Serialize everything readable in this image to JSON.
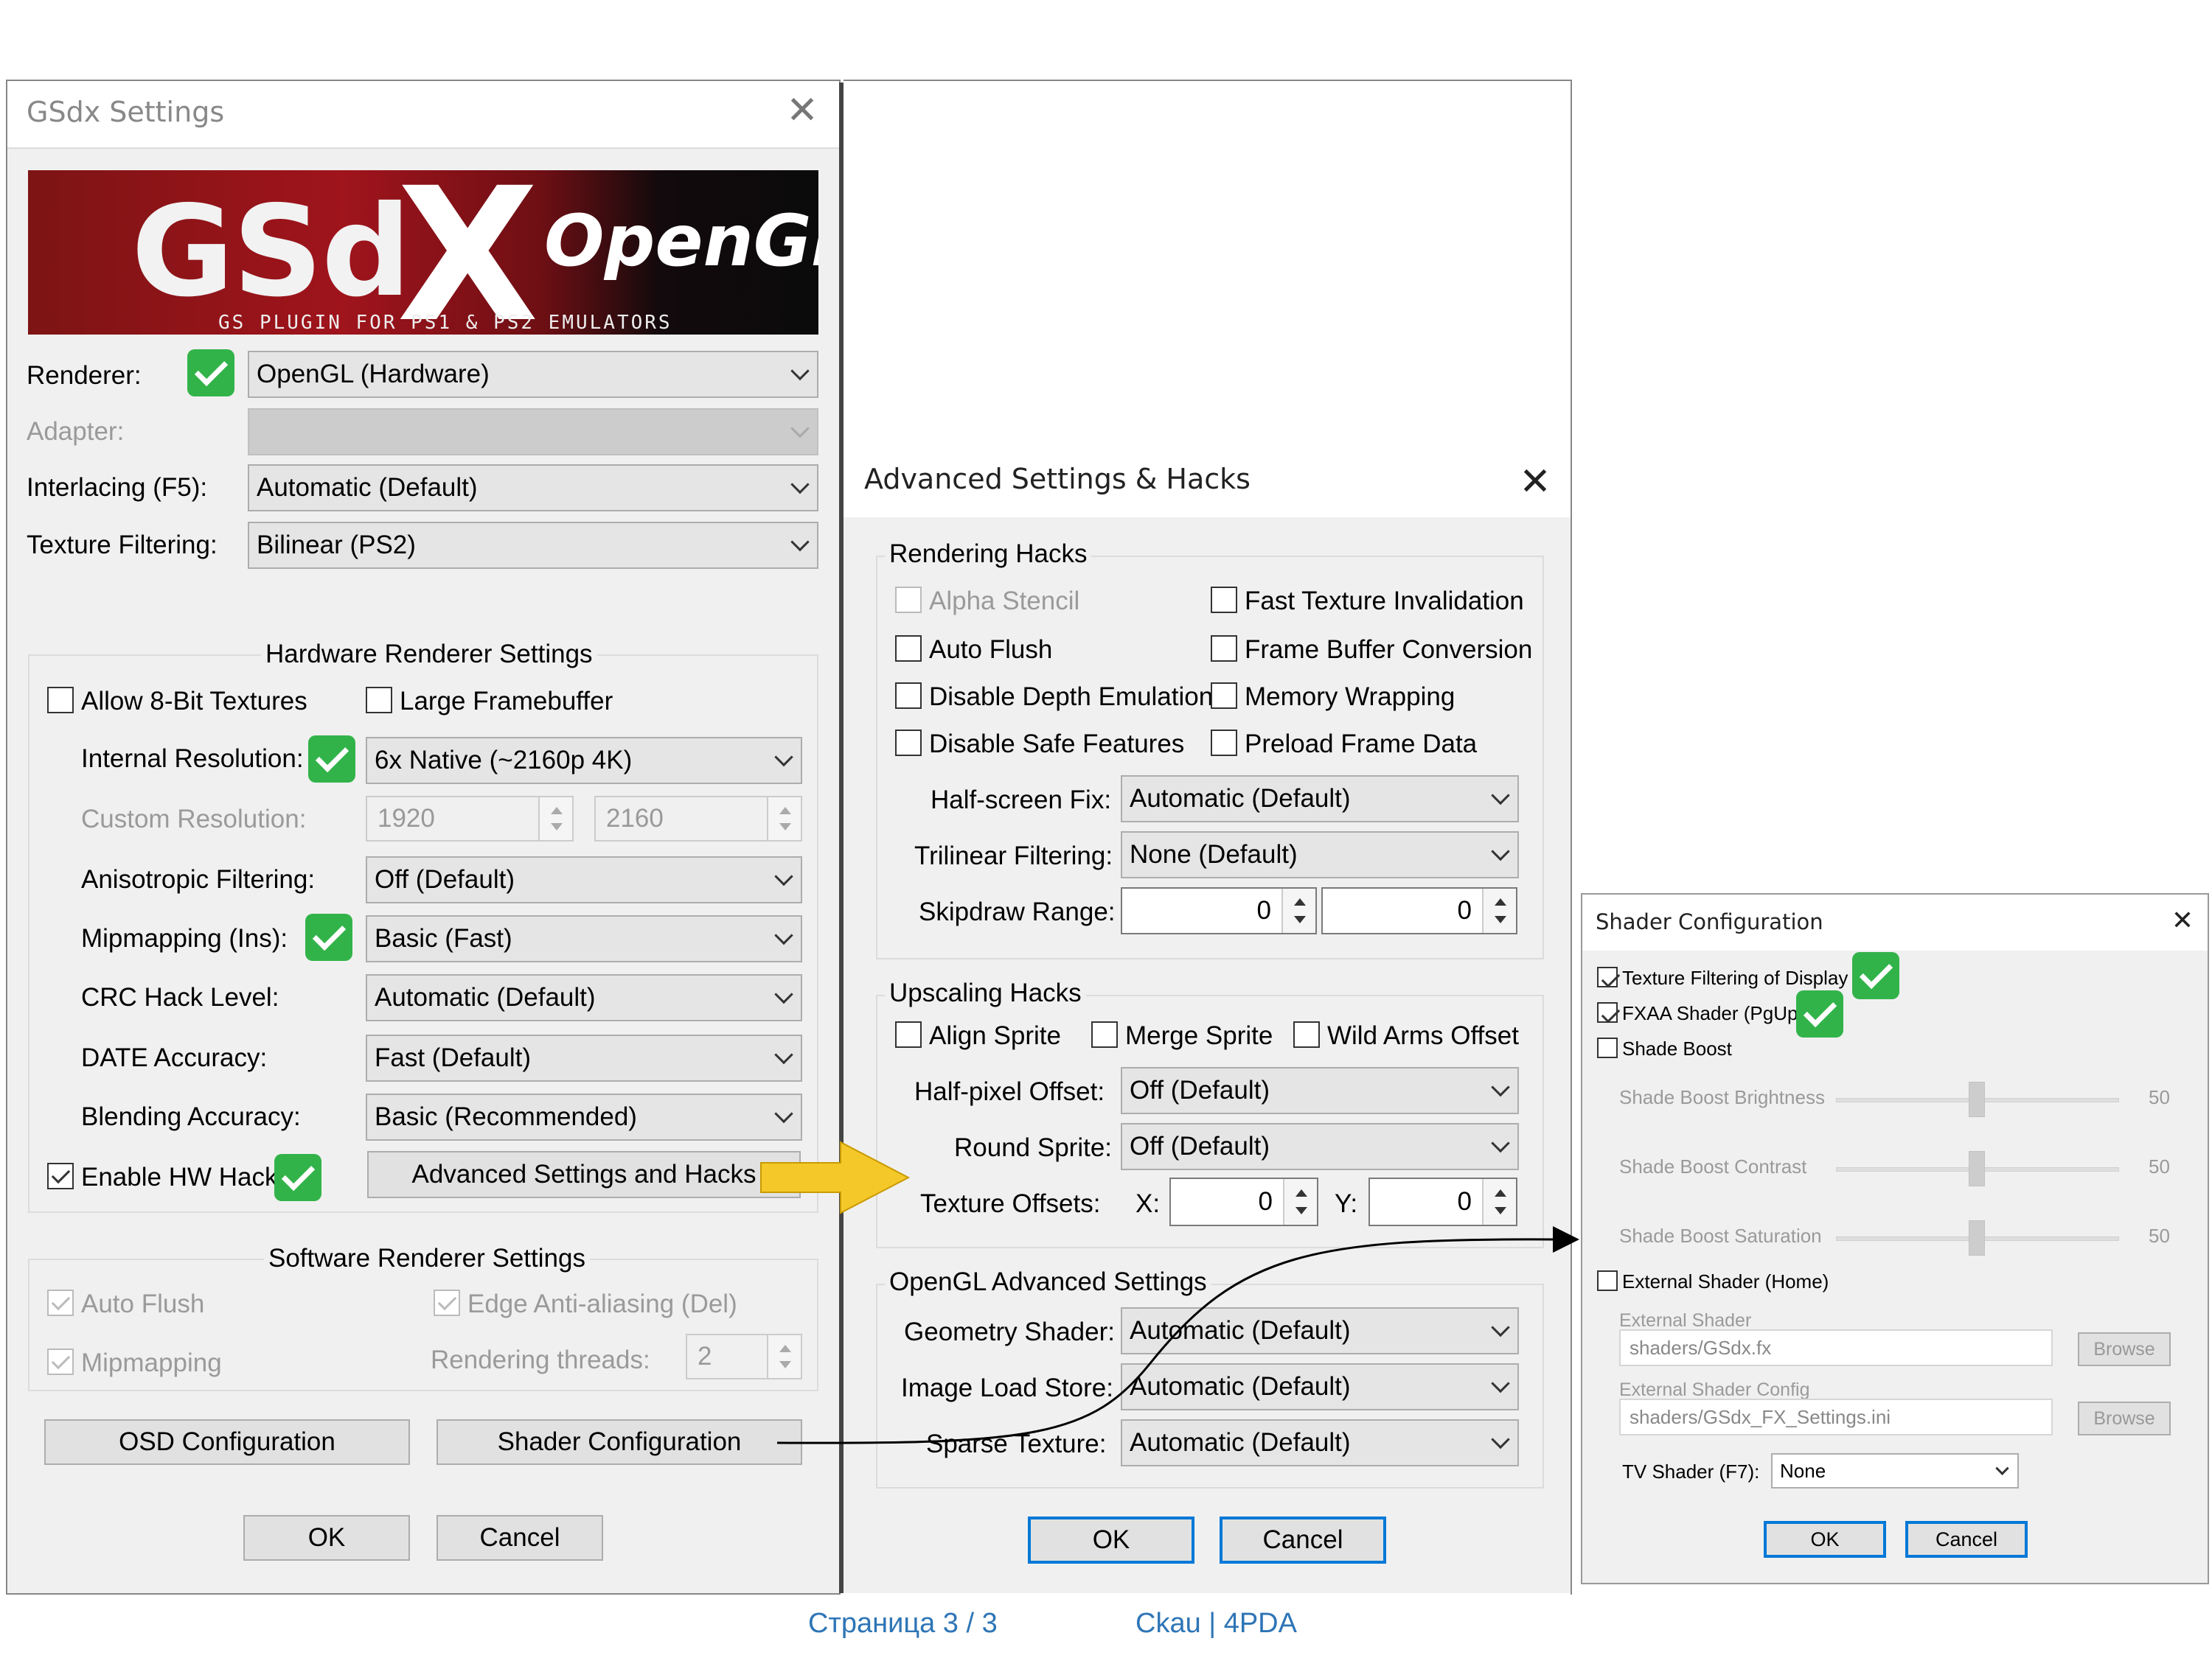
{
  "gsdx": {
    "title": "GSdx Settings",
    "banner": {
      "main": "GSd",
      "x": "X",
      "api": "OpenGL",
      "tagline": "GS PLUGIN FOR PS1 & PS2 EMULATORS"
    },
    "renderer_label": "Renderer:",
    "renderer": "OpenGL (Hardware)",
    "adapter_label": "Adapter:",
    "adapter": "",
    "interlacing_label": "Interlacing (F5):",
    "interlacing": "Automatic (Default)",
    "texfilter_label": "Texture Filtering:",
    "texfilter": "Bilinear (PS2)",
    "hw_group": "Hardware Renderer Settings",
    "allow8bit": "Allow 8-Bit Textures",
    "large_fb": "Large Framebuffer",
    "internal_res_label": "Internal Resolution:",
    "internal_res": "6x Native (~2160p 4K)",
    "custom_res_label": "Custom Resolution:",
    "custom_w": "1920",
    "custom_h": "2160",
    "aniso_label": "Anisotropic Filtering:",
    "aniso": "Off (Default)",
    "mip_label": "Mipmapping (Ins):",
    "mip": "Basic (Fast)",
    "crc_label": "CRC Hack Level:",
    "crc": "Automatic (Default)",
    "date_label": "DATE Accuracy:",
    "date": "Fast (Default)",
    "blend_label": "Blending Accuracy:",
    "blend": "Basic (Recommended)",
    "hwhacks": "Enable HW Hacks",
    "adv_btn": "Advanced Settings and Hacks",
    "sw_group": "Software Renderer Settings",
    "sw_autoflush": "Auto Flush",
    "sw_edge": "Edge Anti-aliasing (Del)",
    "sw_mip": "Mipmapping",
    "threads_label": "Rendering threads:",
    "threads": "2",
    "osd_btn": "OSD Configuration",
    "shader_btn": "Shader Configuration",
    "ok": "OK",
    "cancel": "Cancel"
  },
  "adv": {
    "title": "Advanced Settings & Hacks",
    "rh_group": "Rendering Hacks",
    "alpha_stencil": "Alpha Stencil",
    "fast_tex_inv": "Fast Texture Invalidation",
    "auto_flush": "Auto Flush",
    "fb_conv": "Frame Buffer Conversion",
    "disable_depth": "Disable Depth Emulation",
    "mem_wrap": "Memory Wrapping",
    "disable_safe": "Disable Safe Features",
    "preload": "Preload Frame Data",
    "halfscreen_label": "Half-screen Fix:",
    "halfscreen": "Automatic (Default)",
    "trilinear_label": "Trilinear Filtering:",
    "trilinear": "None (Default)",
    "skipdraw_label": "Skipdraw Range:",
    "skip1": "0",
    "skip2": "0",
    "uh_group": "Upscaling Hacks",
    "align_sprite": "Align Sprite",
    "merge_sprite": "Merge Sprite",
    "wild_arms": "Wild Arms Offset",
    "halfpixel_label": "Half-pixel Offset:",
    "halfpixel": "Off (Default)",
    "round_label": "Round Sprite:",
    "round": "Off (Default)",
    "texoff_label": "Texture Offsets:",
    "x_label": "X:",
    "x": "0",
    "y_label": "Y:",
    "y": "0",
    "gl_group": "OpenGL Advanced Settings",
    "geom_label": "Geometry Shader:",
    "geom": "Automatic (Default)",
    "ils_label": "Image Load Store:",
    "ils": "Automatic (Default)",
    "sparse_label": "Sparse Texture:",
    "sparse": "Automatic (Default)",
    "ok": "OK",
    "cancel": "Cancel"
  },
  "shader": {
    "title": "Shader Configuration",
    "tex_display": "Texture Filtering of Display",
    "fxaa": "FXAA Shader (PgUp)",
    "shade_boost": "Shade Boost",
    "brightness_label": "Shade Boost Brightness",
    "brightness": "50",
    "contrast_label": "Shade Boost Contrast",
    "contrast": "50",
    "saturation_label": "Shade Boost Saturation",
    "saturation": "50",
    "ext_shader": "External Shader (Home)",
    "ext_shader_label": "External Shader",
    "ext_shader_path": "shaders/GSdx.fx",
    "browse": "Browse",
    "ext_config_label": "External Shader Config",
    "ext_config_path": "shaders/GSdx_FX_Settings.ini",
    "tv_label": "TV Shader (F7):",
    "tv": "None",
    "ok": "OK",
    "cancel": "Cancel"
  },
  "footer": {
    "page": "Страница 3 / 3",
    "author": "Ckau | 4PDA",
    "color": "#2e75b6"
  },
  "accents": {
    "tick": "#32b34a",
    "arrow": "#f5c82a",
    "default_button": "#0078d7"
  }
}
